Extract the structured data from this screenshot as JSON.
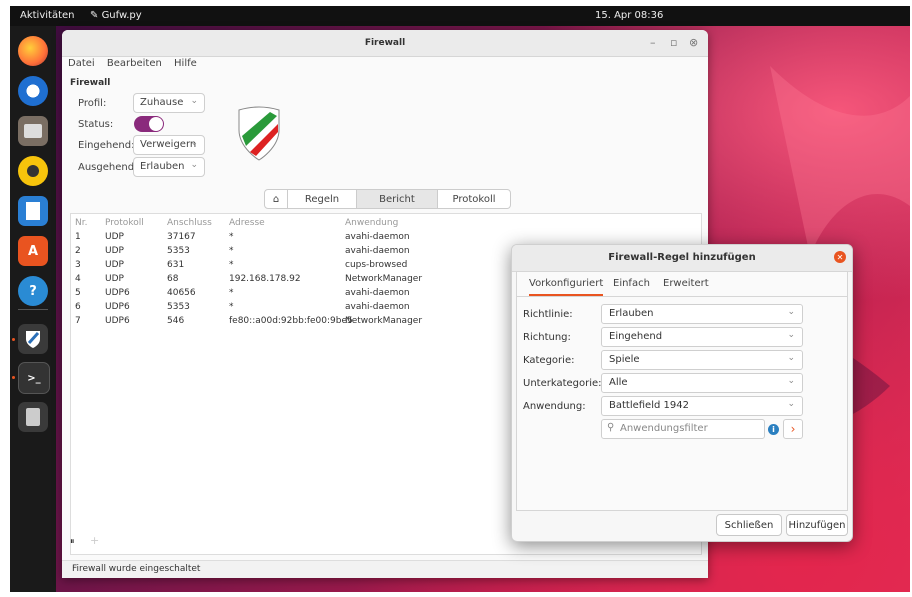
{
  "topbar": {
    "activities": "Aktivitäten",
    "app_name": "Gufw.py",
    "clock": "15. Apr 08:36"
  },
  "dock": {
    "items": [
      "firefox-icon",
      "thunderbird-icon",
      "files-icon",
      "rhythmbox-icon",
      "writer-icon",
      "software-icon",
      "help-icon",
      "gufw-icon",
      "terminal-icon",
      "trash-icon"
    ]
  },
  "window": {
    "title": "Firewall",
    "menu": [
      "Datei",
      "Bearbeiten",
      "Hilfe"
    ],
    "section": "Firewall",
    "profile_label": "Profil:",
    "profile_value": "Zuhause",
    "status_label": "Status:",
    "status_on": true,
    "incoming_label": "Eingehend:",
    "incoming_value": "Verweigern",
    "outgoing_label": "Ausgehend:",
    "outgoing_value": "Erlauben",
    "tabs": [
      "Regeln",
      "Bericht",
      "Protokoll"
    ],
    "selected_tab": "Bericht",
    "report": {
      "headers": [
        "Nr.",
        "Protokoll",
        "Anschluss",
        "Adresse",
        "Anwendung"
      ],
      "rows": [
        [
          "1",
          "UDP",
          "37167",
          "*",
          "avahi-daemon"
        ],
        [
          "2",
          "UDP",
          "5353",
          "*",
          "avahi-daemon"
        ],
        [
          "3",
          "UDP",
          "631",
          "*",
          "cups-browsed"
        ],
        [
          "4",
          "UDP",
          "68",
          "192.168.178.92",
          "NetworkManager"
        ],
        [
          "5",
          "UDP6",
          "40656",
          "*",
          "avahi-daemon"
        ],
        [
          "6",
          "UDP6",
          "5353",
          "*",
          "avahi-daemon"
        ],
        [
          "7",
          "UDP6",
          "546",
          "fe80::a00d:92bb:fe00:9be5",
          "NetworkManager"
        ]
      ]
    },
    "pause_glyph": "⏸",
    "add_glyph": "+",
    "status_text": "Firewall wurde eingeschaltet"
  },
  "dialog": {
    "title": "Firewall-Regel hinzufügen",
    "tabs": [
      "Vorkonfiguriert",
      "Einfach",
      "Erweitert"
    ],
    "selected_tab": "Vorkonfiguriert",
    "fields": [
      {
        "label": "Richtlinie:",
        "value": "Erlauben"
      },
      {
        "label": "Richtung:",
        "value": "Eingehend"
      },
      {
        "label": "Kategorie:",
        "value": "Spiele"
      },
      {
        "label": "Unterkategorie:",
        "value": "Alle"
      },
      {
        "label": "Anwendung:",
        "value": "Battlefield 1942"
      }
    ],
    "filter_placeholder": "Anwendungsfilter",
    "close_button": "Schließen",
    "add_button": "Hinzufügen"
  },
  "colors": {
    "accent": "#e95420",
    "toggle": "#8a2a7c",
    "info": "#2a7fc0"
  }
}
